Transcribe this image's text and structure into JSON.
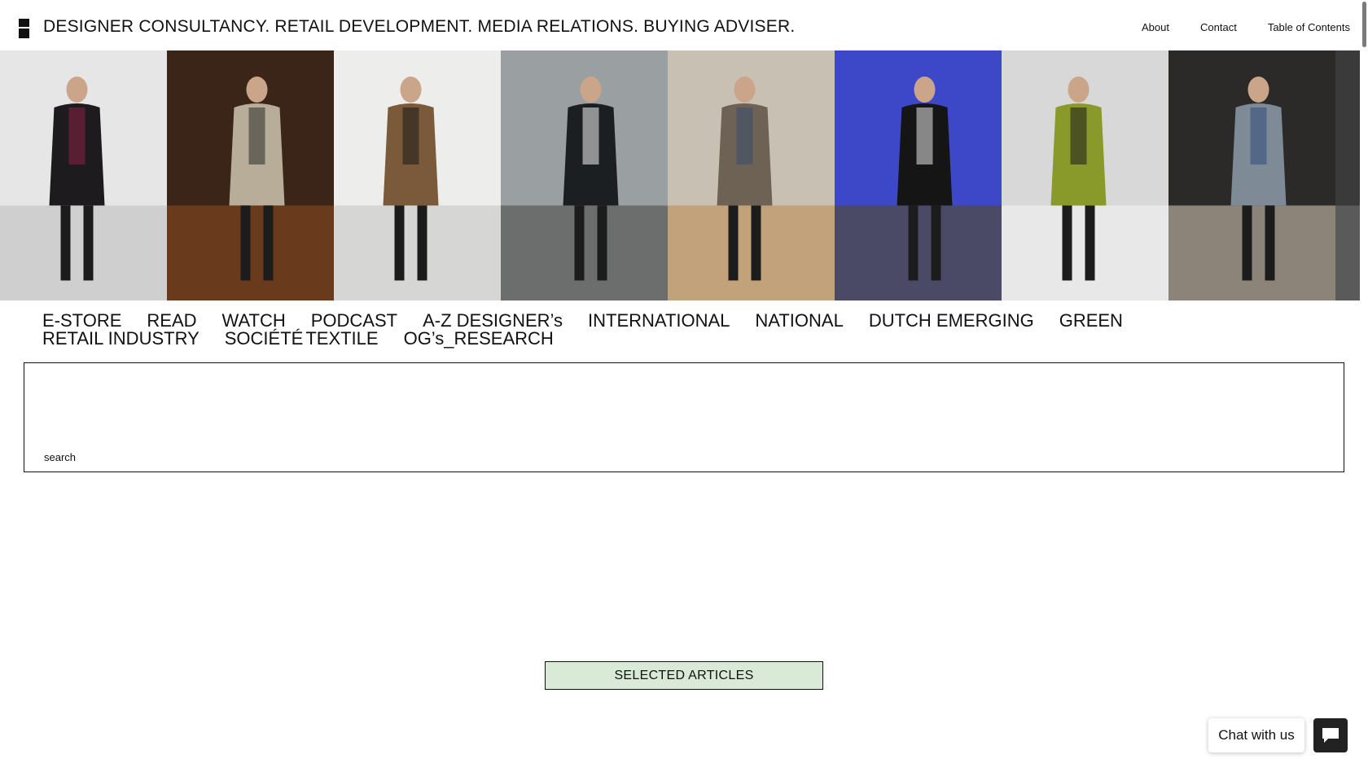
{
  "header": {
    "tagline": [
      "DESIGNER CONSULTANCY.",
      "RETAIL DEVELOPMENT.",
      "MEDIA RELATIONS.",
      "BUYING ADVISER."
    ],
    "nav": {
      "about": "About",
      "contact": "Contact",
      "toc": "Table of Contents"
    }
  },
  "runway_strip": {
    "photos": [
      {
        "bg": "#e6e6e6",
        "floor": "#cfcfcf",
        "outfit": "#1e1b1f",
        "accent": "#8a2040"
      },
      {
        "bg": "#3b2418",
        "floor": "#6a3a1c",
        "outfit": "#b7ad98",
        "accent": "#2a2a2a"
      },
      {
        "bg": "#ededeb",
        "floor": "#d6d6d4",
        "outfit": "#7a5a3a",
        "accent": "#1a1a1a"
      },
      {
        "bg": "#9aa0a2",
        "floor": "#6b6e6c",
        "outfit": "#1b1f22",
        "accent": "#f0f0f0"
      },
      {
        "bg": "#c9c0b4",
        "floor": "#c2a27a",
        "outfit": "#6e6254",
        "accent": "#3a4e6e"
      },
      {
        "bg": "#3d48c8",
        "floor": "#4a4a66",
        "outfit": "#151515",
        "accent": "#e6e6e6"
      },
      {
        "bg": "#d8d8d8",
        "floor": "#e8e8e8",
        "outfit": "#8a9a2a",
        "accent": "#1a1a1a"
      },
      {
        "bg": "#2c2a28",
        "floor": "#8c8478",
        "outfit": "#7e8a96",
        "accent": "#2f4c7a"
      },
      {
        "bg": "#3a3a3a",
        "floor": "#5a5a5a",
        "outfit": "#b03030",
        "accent": "#222222"
      }
    ]
  },
  "categories": {
    "row1": [
      "E-STORE",
      "READ",
      "WATCH",
      "PODCAST",
      "A-Z DESIGNER’s",
      "INTERNATIONAL",
      "NATIONAL",
      "DUTCH EMERGING",
      "GREEN"
    ],
    "row2": [
      "RETAIL INDUSTRY",
      "SOCIÉTÉ",
      "TEXTILE",
      "OG’s_RESEARCH"
    ]
  },
  "search": {
    "placeholder": "search",
    "value": ""
  },
  "selected_articles": "SELECTED ARTICLES",
  "chat": {
    "label": "Chat with us",
    "icon": "chat-icon"
  },
  "colors": {
    "selected_bg": "#d9ead7",
    "chat_bg": "#222222"
  }
}
